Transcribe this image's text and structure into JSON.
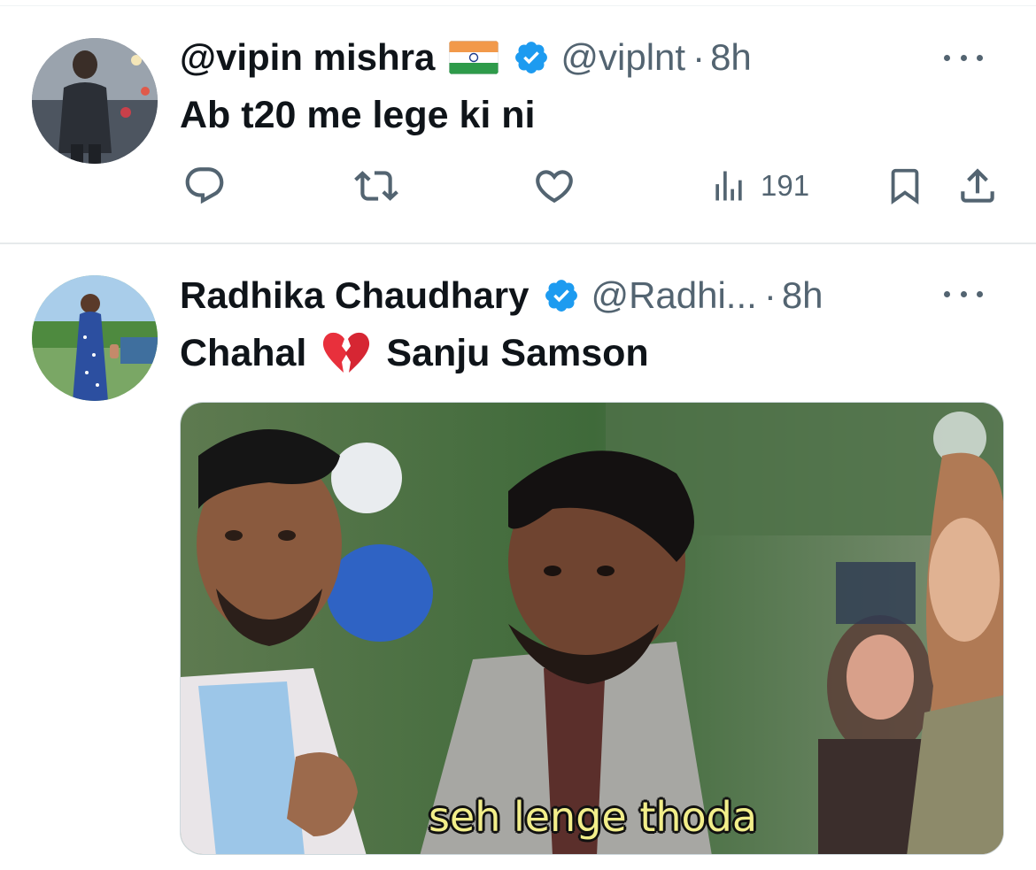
{
  "tweets": [
    {
      "display_name": "@vipin mishra",
      "flag_icon": "india-flag-icon",
      "verified": true,
      "handle": "@viplnt",
      "separator": "·",
      "time": "8h",
      "text": "Ab t20 me lege ki ni",
      "actions": {
        "reply_icon": "reply-icon",
        "retweet_icon": "retweet-icon",
        "like_icon": "heart-icon",
        "views_icon": "views-icon",
        "views_count": "191",
        "bookmark_icon": "bookmark-icon",
        "share_icon": "share-icon"
      }
    },
    {
      "display_name": "Radhika Chaudhary",
      "verified": true,
      "handle": "@Radhi...",
      "separator": "·",
      "time": "8h",
      "text_before": "Chahal",
      "emoji": "broken-heart-emoji",
      "text_after": "Sanju Samson",
      "media": {
        "subtitle": "seh lenge thoda"
      }
    }
  ],
  "colors": {
    "text_primary": "#0f1419",
    "text_secondary": "#536471",
    "verified_blue": "#1d9bf0",
    "divider": "#e6eaeb"
  }
}
